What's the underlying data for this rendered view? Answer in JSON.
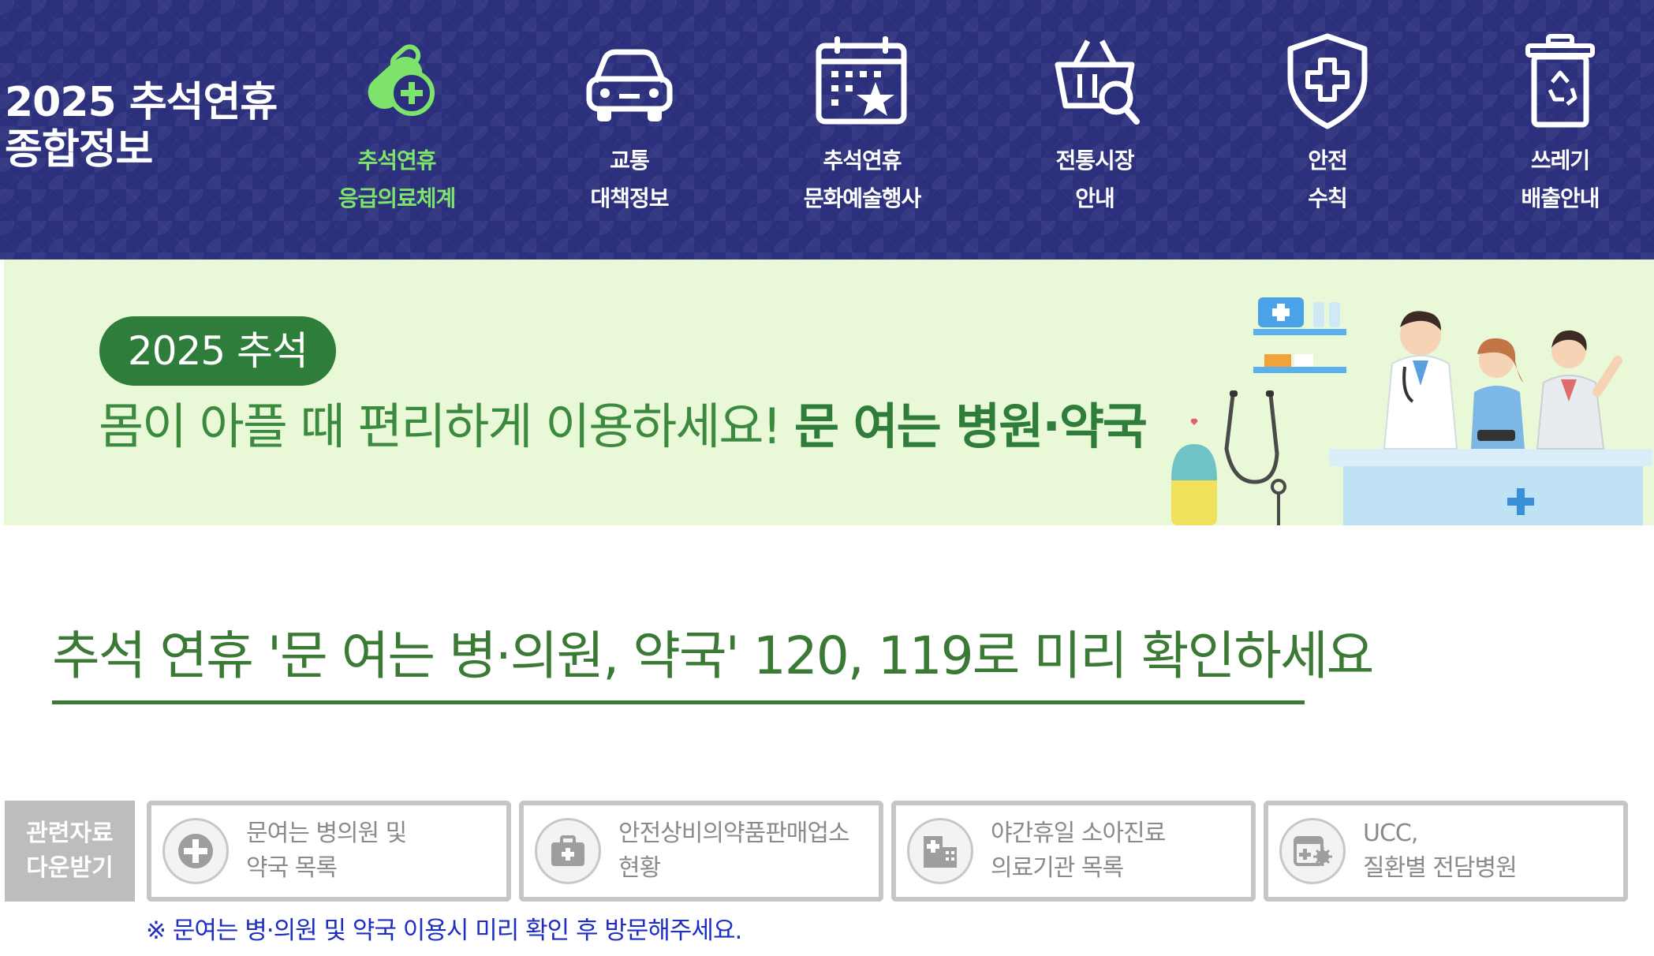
{
  "header": {
    "title_line1": "2025 추석연휴",
    "title_line2": "종합정보",
    "nav": [
      {
        "line1": "추석연휴",
        "line2": "응급의료체계",
        "icon": "pill-plus-icon",
        "active": true
      },
      {
        "line1": "교통",
        "line2": "대책정보",
        "icon": "car-icon",
        "active": false
      },
      {
        "line1": "추석연휴",
        "line2": "문화예술행사",
        "icon": "calendar-star-icon",
        "active": false
      },
      {
        "line1": "전통시장",
        "line2": "안내",
        "icon": "basket-search-icon",
        "active": false
      },
      {
        "line1": "안전",
        "line2": "수칙",
        "icon": "shield-plus-icon",
        "active": false
      },
      {
        "line1": "쓰레기",
        "line2": "배출안내",
        "icon": "recycle-bin-icon",
        "active": false
      }
    ],
    "colors": {
      "background": "#2b2f7c",
      "active_label": "#7ee36a"
    }
  },
  "banner": {
    "pill": "2025 추석",
    "headline_normal": "몸이 아플 때 편리하게 이용하세요!",
    "headline_bold": "문 여는 병원·약국",
    "colors": {
      "background": "#e9f8d7",
      "pill": "#2f7d3a",
      "text": "#3b8a3f"
    }
  },
  "main": {
    "headline": "추석 연휴 '문 여는 병·의원, 약국' 120, 119로 미리 확인하세요",
    "headline_color": "#3a7a34"
  },
  "downloads": {
    "label_line1": "관련자료",
    "label_line2": "다운받기",
    "items": [
      {
        "line1": "문여는 병의원 및",
        "line2": "약국 목록",
        "icon": "plus-circle-icon"
      },
      {
        "line1": "안전상비의약품판매업소",
        "line2": "현황",
        "icon": "medical-kit-icon"
      },
      {
        "line1": "야간휴일 소아진료",
        "line2": "의료기관 목록",
        "icon": "hospital-building-icon"
      },
      {
        "line1": "UCC,",
        "line2": "질환별 전담병원",
        "icon": "clinic-virus-icon"
      }
    ],
    "notice": "※ 문여는 병·의원 및 약국 이용시 미리 확인 후 방문해주세요.",
    "notice_color": "#1f2ec0"
  }
}
